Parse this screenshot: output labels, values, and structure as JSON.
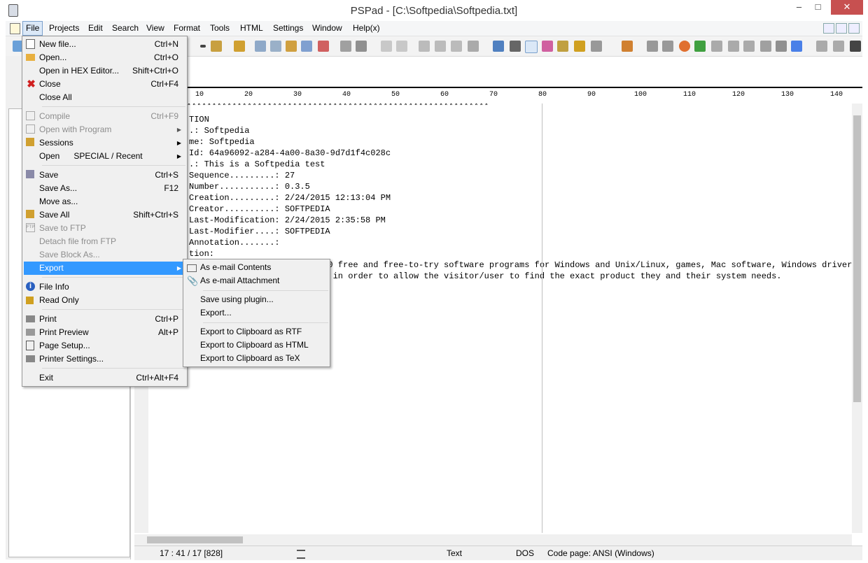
{
  "window": {
    "title": "PSPad - [C:\\Softpedia\\Softpedia.txt]",
    "minimize": "–",
    "maximize": "□",
    "close": "✕"
  },
  "menubar": {
    "items": [
      "File",
      "Projects",
      "Edit",
      "Search",
      "View",
      "Format",
      "Tools",
      "HTML",
      "Settings",
      "Window",
      "Help(x)"
    ]
  },
  "ruler": {
    "marks": [
      "10",
      "20",
      "30",
      "40",
      "50",
      "60",
      "70",
      "80",
      "90",
      "100",
      "110",
      "120",
      "130",
      "140"
    ]
  },
  "editor": {
    "lines": [
      "**************************************************************",
      "TION",
      ".: Softpedia",
      "me: Softpedia",
      "Id: 64a96092-a284-4a00-8a30-9d7d1f4c028c",
      ".: This is a Softpedia test",
      "Sequence.........: 27",
      "Number...........: 0.3.5",
      "Creation.........: 2/24/2015 12:13:04 PM",
      "Creator..........: SOFTPEDIA",
      "Last-Modification: 2/24/2015 2:35:58 PM",
      "Last-Modifier....: SOFTPEDIA",
      "Annotation.......:",
      "tion:",
      "000 free and free-to-try software programs for Windows and Unix/Linux, games, Mac software, Windows driver",
      "ts in order to allow the visitor/user to find the exact product they and their system needs."
    ]
  },
  "status": {
    "position": "17 : 41 / 17  [828]",
    "mode": "Text",
    "eol": "DOS",
    "codepage": "Code page: ANSI (Windows)"
  },
  "file_menu": {
    "items": [
      {
        "label": "New file...",
        "shortcut": "Ctrl+N",
        "icon": "new-file-icon",
        "disabled": false
      },
      {
        "label": "Open...",
        "shortcut": "Ctrl+O",
        "icon": "open-folder-icon",
        "disabled": false
      },
      {
        "label": "Open in HEX Editor...",
        "shortcut": "Shift+Ctrl+O",
        "icon": "",
        "disabled": false
      },
      {
        "label": "Close",
        "shortcut": "Ctrl+F4",
        "icon": "close-red-x-icon",
        "disabled": false
      },
      {
        "label": "Close All",
        "shortcut": "",
        "icon": "",
        "disabled": false
      },
      {
        "label": "Compile",
        "shortcut": "Ctrl+F9",
        "icon": "compile-icon",
        "disabled": true
      },
      {
        "label": "Open with Program",
        "shortcut": "",
        "icon": "open-with-icon",
        "disabled": true,
        "submenu": true
      },
      {
        "label": "Sessions",
        "shortcut": "",
        "icon": "sessions-icon",
        "disabled": false,
        "submenu": true
      },
      {
        "label": "Open      SPECIAL / Recent",
        "shortcut": "",
        "icon": "",
        "disabled": false,
        "submenu": true
      },
      {
        "label": "Save",
        "shortcut": "Ctrl+S",
        "icon": "save-icon",
        "disabled": false
      },
      {
        "label": "Save As...",
        "shortcut": "F12",
        "icon": "",
        "disabled": false
      },
      {
        "label": "Move as...",
        "shortcut": "",
        "icon": "",
        "disabled": false
      },
      {
        "label": "Save All",
        "shortcut": "Shift+Ctrl+S",
        "icon": "save-all-icon",
        "disabled": false
      },
      {
        "label": "Save to FTP",
        "shortcut": "",
        "icon": "ftp-icon",
        "disabled": true
      },
      {
        "label": "Detach file from FTP",
        "shortcut": "",
        "icon": "",
        "disabled": true
      },
      {
        "label": "Save Block As...",
        "shortcut": "",
        "icon": "",
        "disabled": true
      },
      {
        "label": "Export",
        "shortcut": "",
        "icon": "",
        "disabled": false,
        "submenu": true,
        "selected": true
      },
      {
        "label": "File Info",
        "shortcut": "",
        "icon": "info-icon",
        "disabled": false
      },
      {
        "label": "Read Only",
        "shortcut": "",
        "icon": "lock-icon",
        "disabled": false
      },
      {
        "label": "Print",
        "shortcut": "Ctrl+P",
        "icon": "printer-icon",
        "disabled": false
      },
      {
        "label": "Print Preview",
        "shortcut": "Alt+P",
        "icon": "print-preview-icon",
        "disabled": false
      },
      {
        "label": "Page Setup...",
        "shortcut": "",
        "icon": "page-setup-icon",
        "disabled": false
      },
      {
        "label": "Printer Settings...",
        "shortcut": "",
        "icon": "printer-settings-icon",
        "disabled": false
      },
      {
        "label": "Exit",
        "shortcut": "Ctrl+Alt+F4",
        "icon": "",
        "disabled": false
      }
    ]
  },
  "export_menu": {
    "items": [
      {
        "label": "As e-mail Contents",
        "icon": "email-icon"
      },
      {
        "label": "As e-mail Attachment",
        "icon": "paperclip-icon"
      },
      {
        "label": "Save using plugin...",
        "icon": ""
      },
      {
        "label": "Export...",
        "icon": ""
      },
      {
        "label": "Export to Clipboard as RTF",
        "icon": ""
      },
      {
        "label": "Export to Clipboard as HTML",
        "icon": ""
      },
      {
        "label": "Export to Clipboard as TeX",
        "icon": ""
      }
    ]
  },
  "colors": {
    "menu_selection": "#3399ff",
    "current_line": "#ffff99",
    "menubar_active": "#dbe8f7"
  }
}
